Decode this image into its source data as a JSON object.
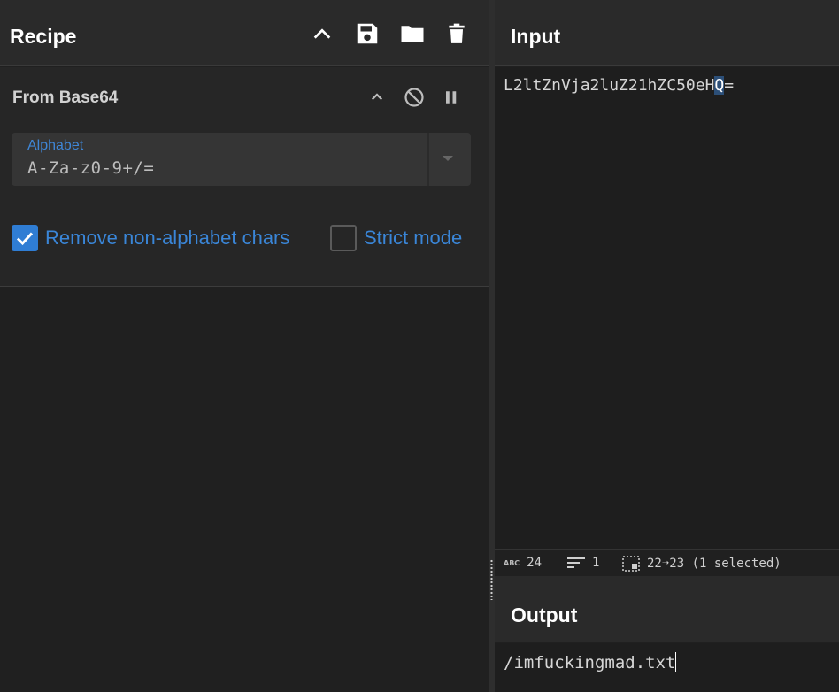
{
  "recipe": {
    "title": "Recipe",
    "header_icons": [
      "chevron-up-icon",
      "save-icon",
      "folder-icon",
      "trash-icon"
    ],
    "operation": {
      "name": "From Base64",
      "controls": [
        "chevron-up-icon",
        "disable-icon",
        "pause-icon"
      ],
      "alphabet": {
        "label": "Alphabet",
        "value": "A-Za-z0-9+/="
      },
      "options": [
        {
          "label": "Remove non-alphabet chars",
          "checked": true
        },
        {
          "label": "Strict mode",
          "checked": false
        }
      ]
    }
  },
  "input": {
    "title": "Input",
    "text_before": "L2ltZnVja2luZ21hZC50eH",
    "text_selected": "Q",
    "text_after": "=",
    "status": {
      "length": "24",
      "lines": "1",
      "selection": "22➝23 (1 selected)"
    }
  },
  "output": {
    "title": "Output",
    "text": "/imfuckingmad.txt"
  },
  "colors": {
    "accent": "#2f7dd4",
    "link": "#3a86d8",
    "panel_header": "#2a2a2a",
    "background": "#202020"
  }
}
